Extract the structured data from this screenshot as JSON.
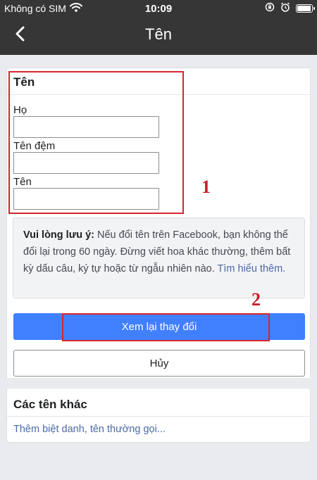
{
  "status_bar": {
    "carrier": "Không có SIM",
    "time": "10:09",
    "icons": [
      "wifi-icon",
      "orientation-lock-icon",
      "alarm-icon",
      "battery-icon"
    ]
  },
  "nav": {
    "back_icon": "chevron-left-icon",
    "title": "Tên"
  },
  "name_section": {
    "title": "Tên",
    "fields": [
      {
        "label": "Họ",
        "value": ""
      },
      {
        "label": "Tên đệm",
        "value": ""
      },
      {
        "label": "Tên",
        "value": ""
      }
    ]
  },
  "notice": {
    "bold": "Vui lòng lưu ý:",
    "text": " Nếu đổi tên trên Facebook, bạn không thể đổi lại trong 60 ngày. Đừng viết hoa khác thường, thêm bất kỳ dấu câu, ký tự hoặc từ ngẫu nhiên nào. ",
    "link": "Tìm hiểu thêm."
  },
  "buttons": {
    "review": "Xem lại thay đổi",
    "cancel": "Hủy"
  },
  "other_names": {
    "title": "Các tên khác",
    "link": "Thêm biệt danh, tên thường gọi..."
  },
  "annotations": {
    "marker_1": "1",
    "marker_2": "2",
    "color": "#d7252f"
  },
  "colors": {
    "header_bg": "#363636",
    "primary_button": "#4080ff",
    "link": "#4b6aa5"
  }
}
